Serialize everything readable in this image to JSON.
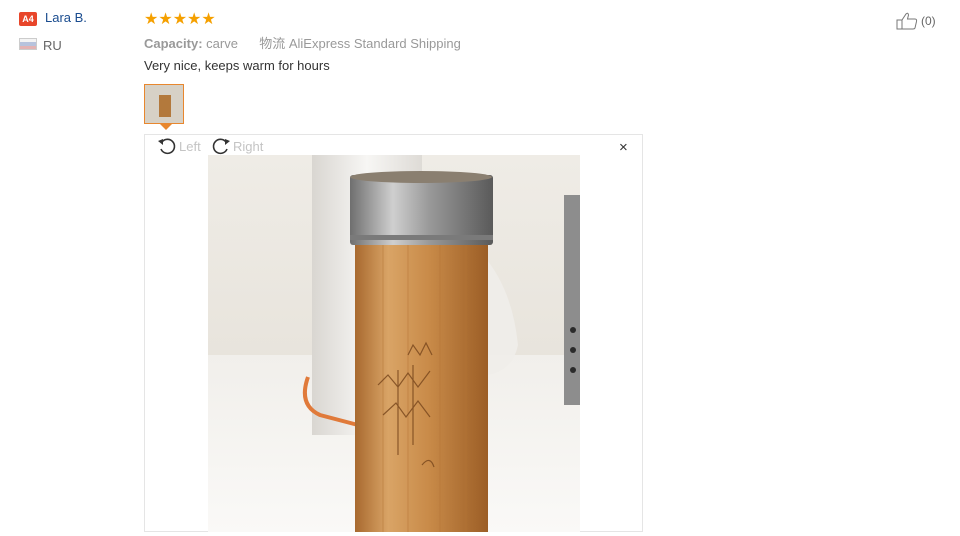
{
  "reviewer": {
    "badge": "A4",
    "name": "Lara B.",
    "country": "RU"
  },
  "review": {
    "rating": 5,
    "stars_text": "★★★★★",
    "capacity_label": "Capacity:",
    "capacity_value": "carve",
    "shipping_label": "物流",
    "shipping_value": "AliExpress Standard Shipping",
    "text": "Very nice, keeps warm for hours",
    "likes": "(0)"
  },
  "viewer": {
    "rotate_left": "Left",
    "rotate_right": "Right",
    "close": "×"
  },
  "colors": {
    "star": "#f5a000",
    "name": "#1a4c8f",
    "badge": "#e8462a",
    "thumb_border": "#e8872e"
  },
  "icons": [
    "thumbs-up-icon",
    "rotate-left-icon",
    "rotate-right-icon",
    "close-icon",
    "flag-icon"
  ]
}
